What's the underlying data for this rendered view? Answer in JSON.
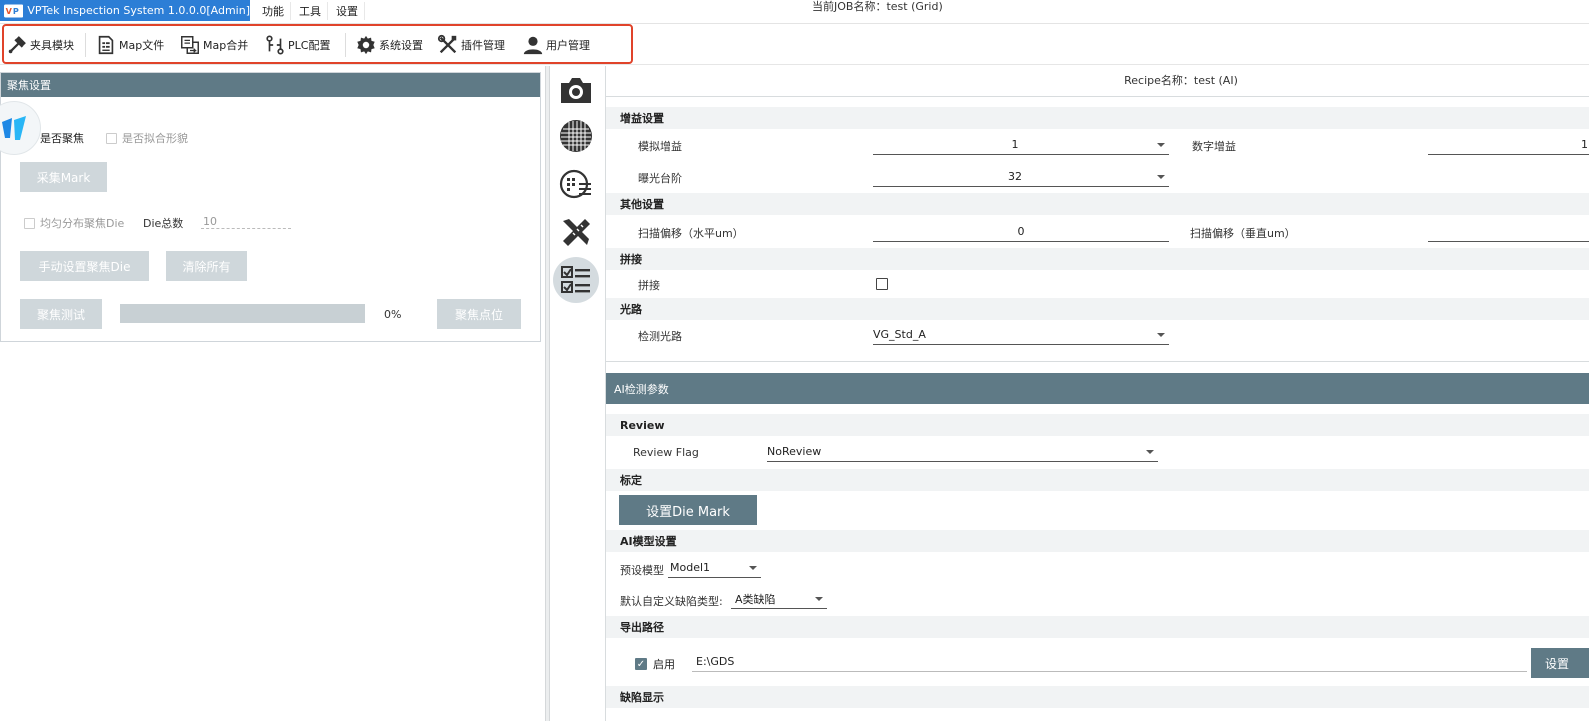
{
  "app": {
    "title": "VPTek Inspection System 1.0.0.0[Admin]",
    "logo_text": "VP",
    "menu": [
      "功能",
      "工具",
      "设置"
    ],
    "job_title": "当前JOB名称：test (Grid)"
  },
  "toolbar": {
    "items": [
      {
        "label": "夹具模块",
        "icon": "fixture-icon"
      },
      {
        "label": "Map文件",
        "icon": "map-file-icon"
      },
      {
        "label": "Map合并",
        "icon": "map-merge-icon"
      },
      {
        "label": "PLC配置",
        "icon": "plc-config-icon"
      },
      {
        "label": "系统设置",
        "icon": "gear-icon"
      },
      {
        "label": "插件管理",
        "icon": "tools-icon"
      },
      {
        "label": "用户管理",
        "icon": "user-icon"
      }
    ],
    "highlight_color": "#e0432a"
  },
  "focus": {
    "header": "聚焦设置",
    "enable_focus_label": "是否聚焦",
    "fit_shape_label": "是否拟合形貌",
    "capture_mark_btn": "采集Mark",
    "even_distribute_label": "均匀分布聚焦Die",
    "die_count_label": "Die总数",
    "die_count_value": "10",
    "manual_set_btn": "手动设置聚焦Die",
    "clear_all_btn": "清除所有",
    "test_btn": "聚焦测试",
    "progress": 0,
    "progress_text": "0%",
    "focus_point_btn": "聚焦点位"
  },
  "side_icons": [
    "camera-icon",
    "grid-icon",
    "wafer-map-icon",
    "ruler-tool-icon",
    "checklist-icon"
  ],
  "recipe": {
    "title": "Recipe名称：test (AI)",
    "gain": {
      "header": "增益设置",
      "analog_label": "模拟增益",
      "analog_value": "1",
      "digital_label": "数字增益",
      "digital_value": "1",
      "exposure_label": "曝光台阶",
      "exposure_value": "32"
    },
    "other": {
      "header": "其他设置",
      "h_offset_label": "扫描偏移（水平um）",
      "h_offset_value": "0",
      "v_offset_label": "扫描偏移（垂直um）"
    },
    "stitch": {
      "header": "拼接",
      "label": "拼接"
    },
    "optics": {
      "header": "光路",
      "label": "检测光路",
      "value": "VG_Std_A"
    }
  },
  "ai": {
    "header": "AI检测参数",
    "review": {
      "header": "Review",
      "flag_label": "Review Flag",
      "flag_value": "NoReview"
    },
    "calibration": {
      "header": "标定",
      "set_die_mark_btn": "设置Die Mark"
    },
    "model": {
      "header": "AI模型设置",
      "preset_label": "预设模型",
      "preset_value": "Model1",
      "defect_type_label": "默认自定义缺陷类型:",
      "defect_type_value": "A类缺陷"
    },
    "export": {
      "header": "导出路径",
      "enable_label": "启用",
      "path": "E:\\GDS",
      "set_btn": "设置"
    },
    "defect_display": {
      "header": "缺陷显示"
    }
  }
}
